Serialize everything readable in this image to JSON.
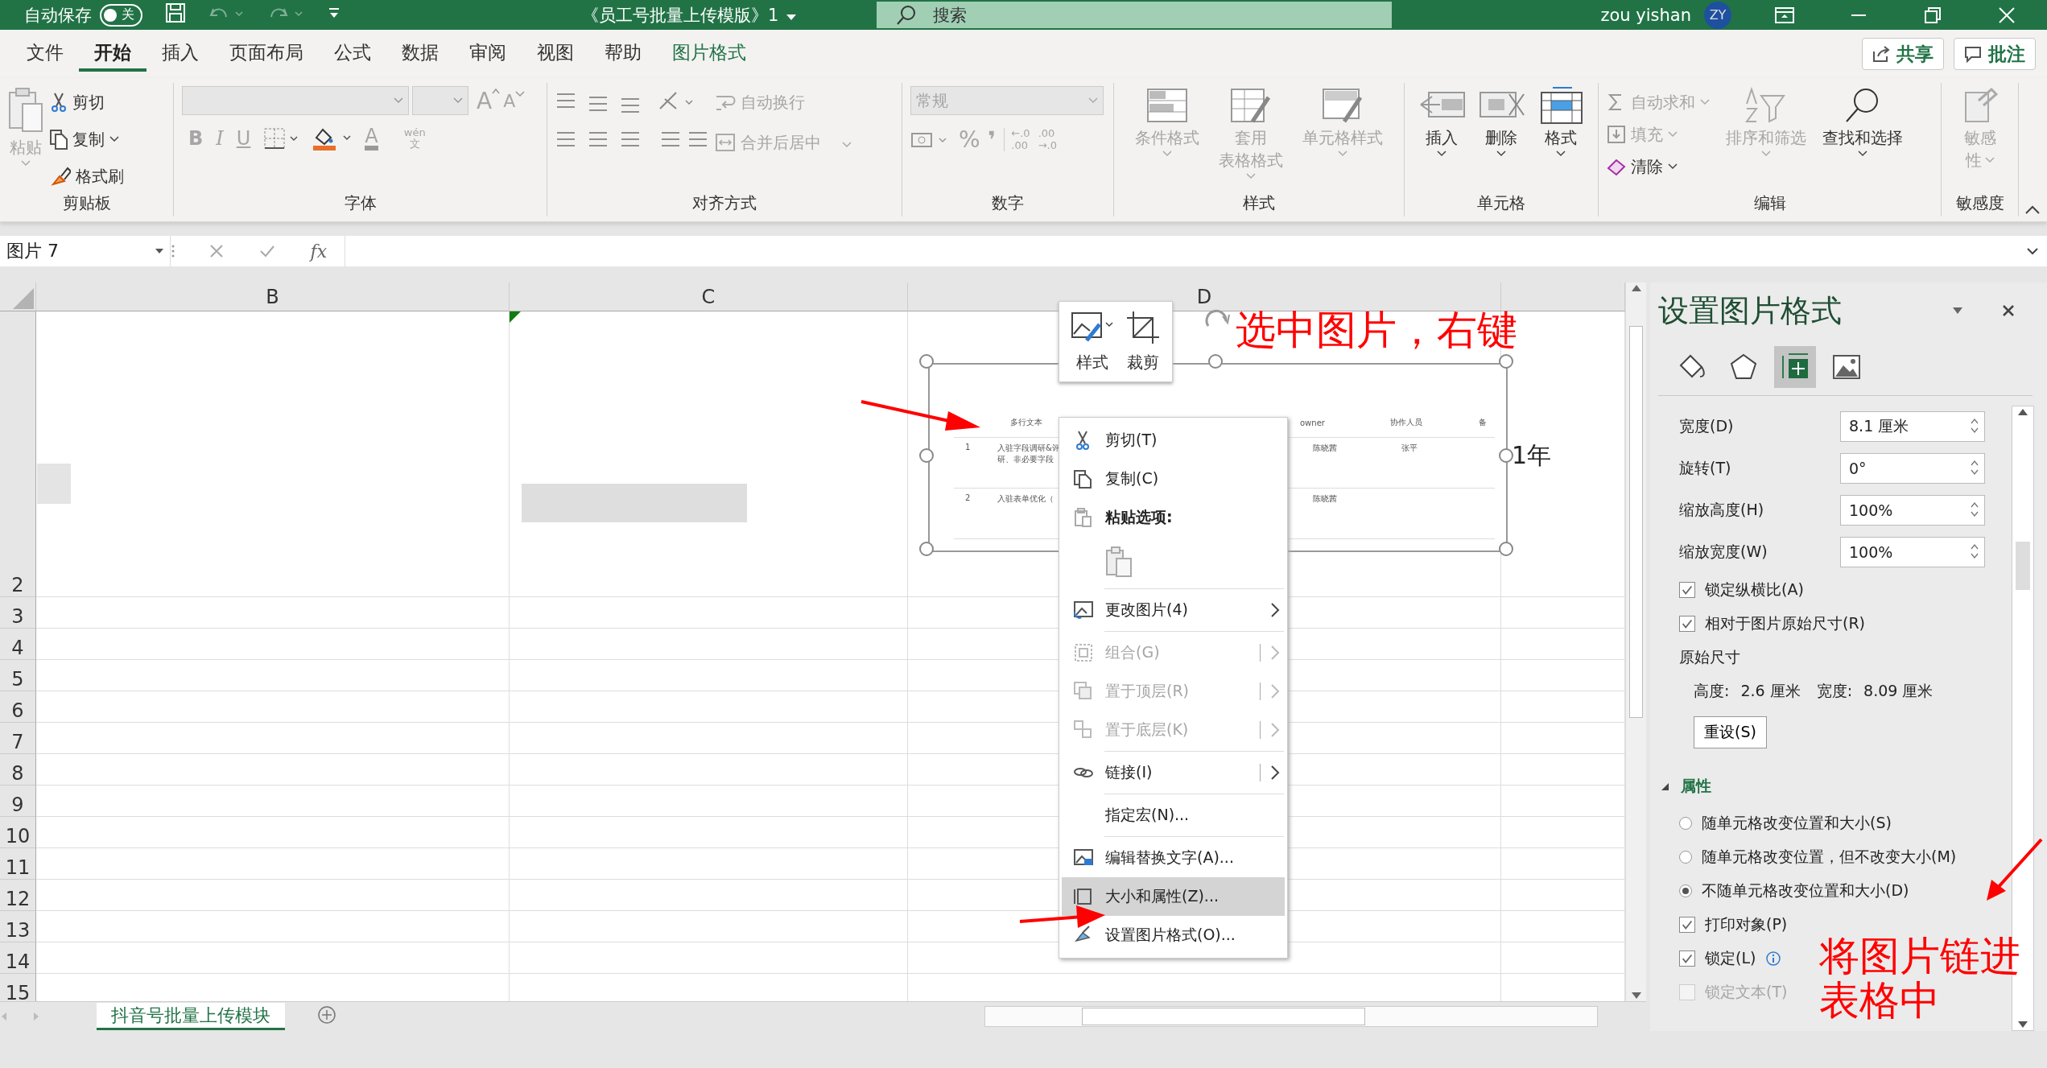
{
  "title_bar": {
    "autosave_label": "自动保存",
    "autosave_toggle": {
      "label": "关",
      "on": false
    },
    "document_title": "《员工号批量上传模版》1",
    "search_placeholder": "搜索",
    "user_name": "zou yishan",
    "avatar_initials": "ZY"
  },
  "menu_tabs": [
    {
      "label": "文件",
      "selected": false,
      "kind": "tab"
    },
    {
      "label": "开始",
      "selected": true,
      "kind": "tab"
    },
    {
      "label": "插入",
      "selected": false,
      "kind": "tab"
    },
    {
      "label": "页面布局",
      "selected": false,
      "kind": "tab"
    },
    {
      "label": "公式",
      "selected": false,
      "kind": "tab"
    },
    {
      "label": "数据",
      "selected": false,
      "kind": "tab"
    },
    {
      "label": "审阅",
      "selected": false,
      "kind": "tab"
    },
    {
      "label": "视图",
      "selected": false,
      "kind": "tab"
    },
    {
      "label": "帮助",
      "selected": false,
      "kind": "tab"
    },
    {
      "label": "图片格式",
      "selected": false,
      "kind": "contextual"
    }
  ],
  "share_button": "共享",
  "comments_button": "批注",
  "ribbon": {
    "clipboard": {
      "label": "剪贴板",
      "paste": {
        "label": "粘贴",
        "disabled": true
      },
      "items": [
        {
          "label": "剪切",
          "disabled": false
        },
        {
          "label": "复制",
          "disabled": false
        },
        {
          "label": "格式刷",
          "disabled": false
        }
      ]
    },
    "font": {
      "label": "字体",
      "disabled": true,
      "grow": "A",
      "shrink": "A",
      "bold": "B",
      "italic": "I",
      "underline": "U",
      "font_color": "A",
      "phonetic": "wén",
      "phonetic_char": "文"
    },
    "alignment": {
      "label": "对齐方式",
      "wrap_text": {
        "label": "自动换行",
        "disabled": true
      },
      "merge": {
        "label": "合并后居中",
        "disabled": true
      }
    },
    "number": {
      "label": "数字",
      "format": "常规",
      "disabled": true,
      "percent": "%",
      "comma": "❜",
      "increase_decimal": [
        "←.0",
        ".00"
      ],
      "decrease_decimal": [
        ".00",
        "→.0"
      ]
    },
    "styles": {
      "label": "样式",
      "items": [
        {
          "lines": [
            "条件格式"
          ],
          "disabled": true,
          "kind": "conditional"
        },
        {
          "lines": [
            "套用",
            "表格格式"
          ],
          "disabled": true,
          "kind": "table"
        },
        {
          "lines": [
            "单元格样式"
          ],
          "disabled": true,
          "kind": "cellstyle"
        }
      ]
    },
    "cells": {
      "label": "单元格",
      "items": [
        {
          "label": "插入",
          "disabled": false,
          "kind": "insert"
        },
        {
          "label": "删除",
          "disabled": false,
          "kind": "delete"
        },
        {
          "label": "格式",
          "disabled": false,
          "kind": "format"
        }
      ]
    },
    "editing": {
      "label": "编辑",
      "small": [
        {
          "label": "自动求和",
          "disabled": true,
          "kind": "sum"
        },
        {
          "label": "填充",
          "disabled": true,
          "kind": "fill"
        },
        {
          "label": "清除",
          "disabled": false,
          "kind": "clear"
        }
      ],
      "large": [
        {
          "label": "排序和筛选",
          "disabled": true,
          "kind": "sort"
        },
        {
          "label": "查找和选择",
          "disabled": false,
          "kind": "find"
        }
      ]
    },
    "sensitivity": {
      "label": "敏感度",
      "button": {
        "lines": [
          "敏感",
          "性"
        ],
        "disabled": true
      }
    }
  },
  "formula_bar": {
    "name_box": "图片 7",
    "fx": "fx"
  },
  "sheet": {
    "columns": [
      "B",
      "C",
      "D"
    ],
    "rows": [
      "2",
      "3",
      "4",
      "5",
      "6",
      "7",
      "8",
      "9",
      "10",
      "11",
      "12",
      "13",
      "14",
      "15"
    ],
    "cell_text": "1年",
    "embedded_picture": {
      "headers": [
        "多行文本",
        "owner",
        "协作人员",
        "备"
      ],
      "rows": [
        {
          "num": "1",
          "text": "入驻字段调研&评",
          "text2": "研、非必要字段",
          "owner": "陈晓茜",
          "collaborator": "张平"
        },
        {
          "num": "2",
          "text": "入驻表单优化（",
          "owner": "陈晓茜"
        }
      ]
    },
    "mini_toolbar": [
      {
        "label": "样式",
        "kind": "style"
      },
      {
        "label": "裁剪",
        "kind": "crop"
      }
    ],
    "context_menu": [
      {
        "kind": "item",
        "label": "剪切(T)",
        "disabled": false,
        "submenu": false,
        "selected": false
      },
      {
        "kind": "item",
        "label": "复制(C)",
        "disabled": false,
        "submenu": false,
        "selected": false
      },
      {
        "kind": "header",
        "label": "粘贴选项:"
      },
      {
        "kind": "paste"
      },
      {
        "kind": "separator"
      },
      {
        "kind": "item",
        "label": "更改图片(4)",
        "disabled": false,
        "submenu": true,
        "selected": false
      },
      {
        "kind": "separator"
      },
      {
        "kind": "item",
        "label": "组合(G)",
        "disabled": true,
        "submenu": true,
        "selected": false
      },
      {
        "kind": "item",
        "label": "置于顶层(R)",
        "disabled": true,
        "submenu": true,
        "selected": false
      },
      {
        "kind": "item",
        "label": "置于底层(K)",
        "disabled": true,
        "submenu": true,
        "selected": false
      },
      {
        "kind": "separator"
      },
      {
        "kind": "item",
        "label": "链接(I)",
        "disabled": false,
        "submenu": true,
        "selected": false
      },
      {
        "kind": "separator"
      },
      {
        "kind": "item",
        "label": "指定宏(N)...",
        "disabled": false,
        "submenu": false,
        "selected": false
      },
      {
        "kind": "separator"
      },
      {
        "kind": "item",
        "label": "编辑替换文字(A)...",
        "disabled": false,
        "submenu": false,
        "selected": false
      },
      {
        "kind": "item",
        "label": "大小和属性(Z)...",
        "disabled": false,
        "submenu": false,
        "selected": true
      },
      {
        "kind": "item",
        "label": "设置图片格式(O)...",
        "disabled": false,
        "submenu": false,
        "selected": false
      }
    ],
    "annotations": [
      {
        "text": "选中图片，右键"
      },
      {
        "text": "将图片链进表格中"
      }
    ],
    "sheet_tabs": [
      {
        "label": "抖音号批量上传模块",
        "selected": true
      }
    ]
  },
  "format_panel": {
    "title": "设置图片格式",
    "category_tabs": [
      {
        "kind": "fill",
        "selected": false
      },
      {
        "kind": "effects",
        "selected": false
      },
      {
        "kind": "size",
        "selected": true
      },
      {
        "kind": "picture",
        "selected": false
      }
    ],
    "fields": [
      {
        "label": "宽度(D)",
        "value": "8.1 厘米"
      },
      {
        "label": "旋转(T)",
        "value": "0°"
      },
      {
        "label": "缩放高度(H)",
        "value": "100%"
      },
      {
        "label": "缩放宽度(W)",
        "value": "100%"
      }
    ],
    "size_checks": [
      {
        "label": "锁定纵横比(A)",
        "checked": true
      },
      {
        "label": "相对于图片原始尺寸(R)",
        "checked": true
      }
    ],
    "original_size": {
      "label": "原始尺寸",
      "height_label": "高度:",
      "height": "2.6 厘米",
      "width_label": "宽度:",
      "width": "8.09 厘米"
    },
    "reset_button": "重设(S)",
    "properties": {
      "label": "属性",
      "expanded": true,
      "options": [
        {
          "label": "随单元格改变位置和大小(S)",
          "selected": false
        },
        {
          "label": "随单元格改变位置，但不改变大小(M)",
          "selected": false
        },
        {
          "label": "不随单元格改变位置和大小(D)",
          "selected": true
        }
      ],
      "checks": [
        {
          "label": "打印对象(P)",
          "checked": true,
          "disabled": false,
          "info": false
        },
        {
          "label": "锁定(L)",
          "checked": true,
          "disabled": false,
          "info": true
        },
        {
          "label": "锁定文本(T)",
          "checked": false,
          "disabled": true,
          "info": false
        }
      ]
    }
  }
}
